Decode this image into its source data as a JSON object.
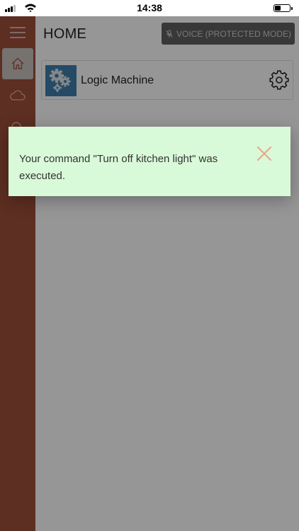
{
  "status_bar": {
    "time": "14:38",
    "battery_level": 0.38
  },
  "sidebar": {
    "items": [
      {
        "icon": "menu-icon"
      },
      {
        "icon": "home-icon",
        "active": true
      },
      {
        "icon": "cloud-icon"
      },
      {
        "icon": "search-icon"
      }
    ]
  },
  "header": {
    "title": "HOME",
    "voice_button_label": "VOICE (PROTECTED MODE)"
  },
  "devices": [
    {
      "name": "Logic Machine",
      "icon": "gears-icon",
      "settings_icon": "gear-icon"
    }
  ],
  "toast": {
    "message": "Your command \"Turn off kitchen light\" was executed.",
    "close_icon": "close-icon"
  },
  "colors": {
    "sidebar": "#9f4f3b",
    "toast_background": "#d9fad8",
    "close_icon": "#e8a890",
    "device_icon_background": "#3f7fad"
  }
}
